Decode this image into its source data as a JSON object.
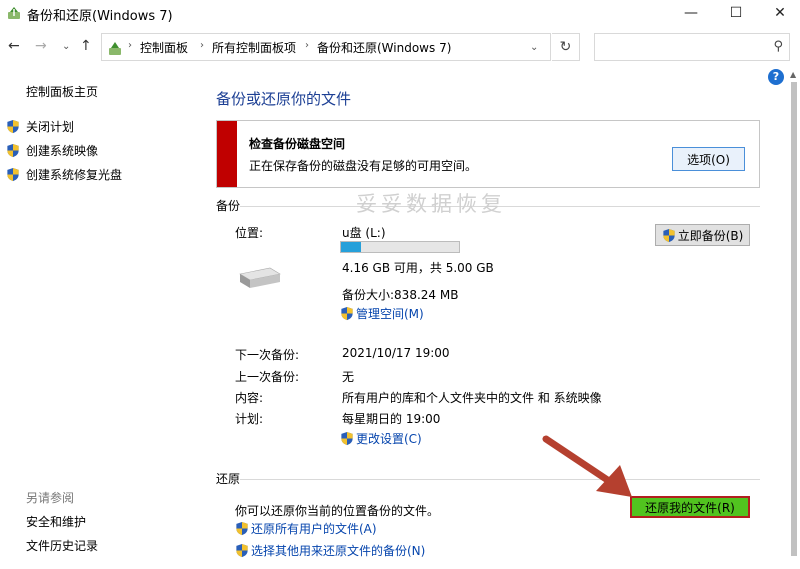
{
  "window": {
    "title": "备份和还原(Windows 7)",
    "minimize": "—",
    "maximize": "☐",
    "close": "✕"
  },
  "nav": {
    "back": "←",
    "forward": "→",
    "history": "⌄",
    "up": "↑",
    "breadcrumbs": [
      "控制面板",
      "所有控制面板项",
      "备份和还原(Windows 7)"
    ],
    "crumb_separator": "›",
    "dropdown": "⌄",
    "refresh": "↻",
    "search_placeholder": "",
    "search_glyph": "⚲"
  },
  "sidebar": {
    "home": "控制面板主页",
    "items": [
      {
        "label": "关闭计划",
        "icon": "shield-icon"
      },
      {
        "label": "创建系统映像",
        "icon": "shield-icon"
      },
      {
        "label": "创建系统修复光盘",
        "icon": "shield-icon"
      }
    ],
    "see_also_title": "另请参阅",
    "see_also": [
      "安全和维护",
      "文件历史记录"
    ]
  },
  "help_label": "?",
  "main": {
    "title": "备份或还原你的文件",
    "alert": {
      "title": "检查备份磁盘空间",
      "description": "正在保存备份的磁盘没有足够的可用空间。",
      "button": "选项(O)",
      "color": "#c00000"
    },
    "watermark": "妥妥数据恢复",
    "backup": {
      "section": "备份",
      "location_label": "位置:",
      "drive_name": "u盘 (L:)",
      "usage_fraction": 0.17,
      "free_text": "4.16 GB 可用，共 5.00 GB",
      "size_text": "备份大小:838.24 MB",
      "manage_link": "管理空间(M)",
      "backup_now": "立即备份(B)",
      "next_label": "下一次备份:",
      "next_value": "2021/10/17 19:00",
      "last_label": "上一次备份:",
      "last_value": "无",
      "content_label": "内容:",
      "content_value": "所有用户的库和个人文件夹中的文件 和 系统映像",
      "schedule_label": "计划:",
      "schedule_value": "每星期日的 19:00",
      "change_link": "更改设置(C)"
    },
    "restore": {
      "section": "还原",
      "description": "你可以还原你当前的位置备份的文件。",
      "restore_my_files": "还原我的文件(R)",
      "restore_all_link": "还原所有用户的文件(A)",
      "select_other_link": "选择其他用来还原文件的备份(N)",
      "button_color": "#51c31f",
      "annotation_color": "#b5402f"
    }
  }
}
